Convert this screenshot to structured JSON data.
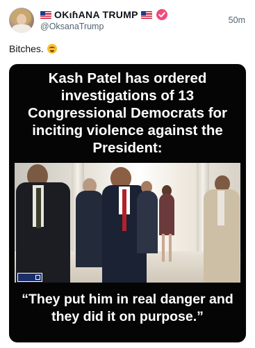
{
  "post": {
    "author": {
      "display_name": "OKιɦANA TRUMP",
      "handle": "@OksanaTrump",
      "verified_icon": "verified-badge-icon",
      "flag_icon": "us-flag-icon"
    },
    "time": "50m",
    "text": "Bitches.",
    "emoji_icon": "grimacing-smile-emoji-icon"
  },
  "media": {
    "headline": "Kash Patel has ordered investigations of 13 Congressional Democrats for inciting violence against the President:",
    "quote": "“They put him in real danger and they did it on purpose.”"
  },
  "colors": {
    "verified": "#f14a7c",
    "secondary_text": "#536471",
    "media_background": "#050505"
  }
}
